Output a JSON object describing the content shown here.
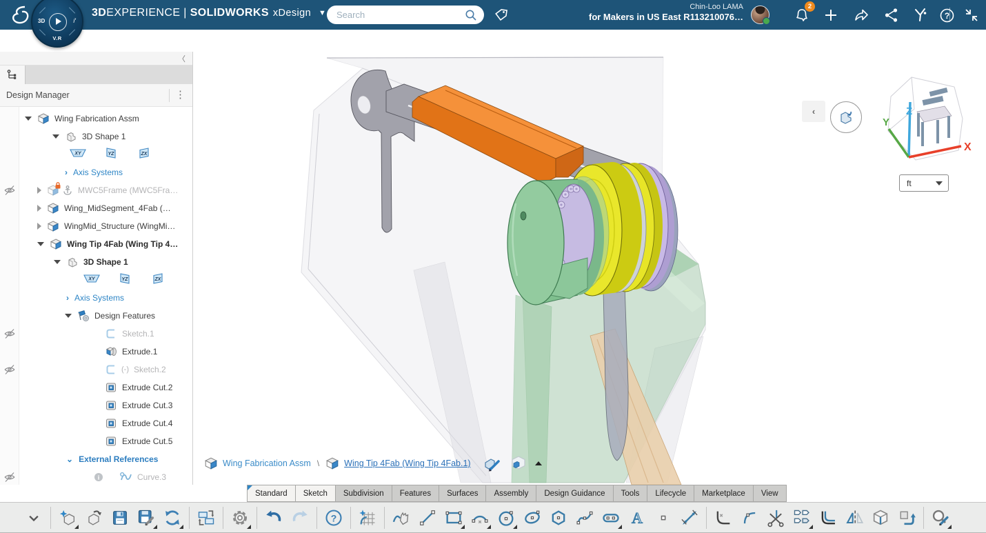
{
  "topbar": {
    "brand": {
      "bold": "3D",
      "rest": "EXPERIENCE",
      "divider": "|",
      "product": "SOLIDWORKS",
      "app": "xDesign"
    },
    "search": {
      "placeholder": "Search"
    },
    "user": {
      "name": "Chin-Loo LAMA",
      "platform": "for Makers in US East R113210076…"
    },
    "notifications": {
      "count": "2"
    },
    "compass": {
      "label_left": "3D",
      "label_right": "i′",
      "label_bottom": "V.R"
    }
  },
  "panel": {
    "title": "Design Manager",
    "tree": [
      {
        "type": "item",
        "pad": 36,
        "expander": "open",
        "icon": "assembly",
        "label": "Wing Fabrication Assm"
      },
      {
        "type": "item",
        "pad": 76,
        "expander": "open",
        "icon": "shape3d",
        "label": "3D Shape 1"
      },
      {
        "type": "planes",
        "pad": 100,
        "planes": [
          "XY",
          "YZ",
          "ZX"
        ]
      },
      {
        "type": "axis",
        "pad": 94,
        "label": "Axis Systems"
      },
      {
        "type": "item",
        "pad": 54,
        "expander": "closed",
        "icon": "assembly-locked",
        "extra": "anchor",
        "label": "MWC5Frame (MWC5Fra…",
        "gray": true,
        "hidden": true
      },
      {
        "type": "item",
        "pad": 54,
        "expander": "closed",
        "icon": "assembly",
        "label": "Wing_MidSegment_4Fab (…"
      },
      {
        "type": "item",
        "pad": 54,
        "expander": "closed",
        "icon": "assembly",
        "label": "WingMid_Structure (WingMi…"
      },
      {
        "type": "item",
        "pad": 54,
        "expander": "open",
        "icon": "assembly",
        "label": "Wing Tip 4Fab (Wing Tip 4…",
        "bold": true
      },
      {
        "type": "item",
        "pad": 78,
        "expander": "open",
        "icon": "shape3d",
        "label": "3D Shape 1",
        "bold": true
      },
      {
        "type": "planes",
        "pad": 120,
        "planes": [
          "XY",
          "YZ",
          "ZX"
        ]
      },
      {
        "type": "axis",
        "pad": 96,
        "label": "Axis Systems"
      },
      {
        "type": "item",
        "pad": 94,
        "expander": "open",
        "icon": "features",
        "label": "Design Features"
      },
      {
        "type": "item",
        "pad": 134,
        "icon": "sketch",
        "label": "Sketch.1",
        "gray": true,
        "hidden": true
      },
      {
        "type": "item",
        "pad": 134,
        "icon": "extrude",
        "label": "Extrude.1"
      },
      {
        "type": "item",
        "pad": 134,
        "icon": "sketch",
        "prefix": "(-)",
        "label": "Sketch.2",
        "gray": true,
        "hidden": true
      },
      {
        "type": "item",
        "pad": 134,
        "icon": "extrude-cut",
        "label": "Extrude Cut.2"
      },
      {
        "type": "item",
        "pad": 134,
        "icon": "extrude-cut",
        "label": "Extrude Cut.3"
      },
      {
        "type": "item",
        "pad": 134,
        "icon": "extrude-cut",
        "label": "Extrude Cut.4"
      },
      {
        "type": "item",
        "pad": 134,
        "icon": "extrude-cut",
        "label": "Extrude Cut.5"
      },
      {
        "type": "extref",
        "pad": 96,
        "label": "External References"
      },
      {
        "type": "item",
        "pad": 134,
        "icon": "curve",
        "extra": "info",
        "label": "Curve.3",
        "gray": true,
        "hidden": true
      }
    ]
  },
  "viewport": {
    "breadcrumb": {
      "root": "Wing Fabrication Assm",
      "separator": "\\",
      "current": "Wing Tip 4Fab (Wing Tip 4Fab.1)"
    },
    "units": {
      "value": "ft"
    },
    "axes": {
      "x": "X",
      "y": "Y",
      "z": "Z"
    }
  },
  "tabs": [
    {
      "label": "Standard",
      "state": "active"
    },
    {
      "label": "Sketch",
      "state": "light"
    },
    {
      "label": "Subdivision"
    },
    {
      "label": "Features"
    },
    {
      "label": "Surfaces"
    },
    {
      "label": "Assembly"
    },
    {
      "label": "Design Guidance"
    },
    {
      "label": "Tools"
    },
    {
      "label": "Lifecycle"
    },
    {
      "label": "Marketplace"
    },
    {
      "label": "View"
    }
  ],
  "toolbar": {
    "groups": [
      [
        "collapse"
      ],
      [
        "new-part",
        "open-part",
        "save",
        "save-options",
        "sync"
      ],
      [
        "transfer-content"
      ],
      [
        "settings"
      ],
      [
        "undo",
        "redo"
      ],
      [
        "help"
      ],
      [
        "new-sketch"
      ],
      [
        "freehand",
        "line",
        "rectangle",
        "arc",
        "circle",
        "ellipse",
        "polygon",
        "spline",
        "slot",
        "text",
        "point",
        "smart-dimension"
      ],
      [
        "fillet",
        "arc-blend",
        "trim",
        "pattern",
        "offset",
        "mirror",
        "project",
        "convert-entities"
      ],
      [
        "measure"
      ]
    ],
    "flyout": [
      "new-part",
      "save-options",
      "sync",
      "settings",
      "rectangle",
      "arc",
      "circle",
      "slot",
      "pattern",
      "measure"
    ]
  }
}
